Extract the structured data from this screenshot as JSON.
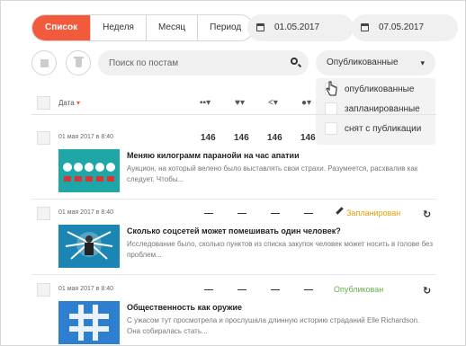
{
  "view_tabs": [
    "Список",
    "Неделя",
    "Месяц",
    "Период"
  ],
  "date_from": "01.05.2017",
  "date_to": "07.05.2017",
  "date_dash": "—",
  "search": {
    "placeholder": "Поиск по постам"
  },
  "status_filter": {
    "selected": "Опубликованные",
    "options": [
      "опубликованные",
      "запланированные",
      "снят с публикации"
    ]
  },
  "table_header": {
    "date_label": "Дата",
    "sort_arrow": "▾"
  },
  "posts": [
    {
      "date": "01 мая 2017 в 8:40",
      "socials": "— ▾ ◉ in",
      "stats": [
        "146",
        "146",
        "146",
        "146"
      ],
      "status": "",
      "title": "Меняю килограмм паранойи на час апатии",
      "desc": "Аукцион, на который велено было выставлять свои страхи. Разумеется, расхвалив как следует. Чтобы..."
    },
    {
      "date": "01 мая 2017 в 8:40",
      "socials": "— vk f ◎ f",
      "stats": [
        "—",
        "—",
        "—",
        "—"
      ],
      "status": "Запланирован",
      "status_color": "#e8a000",
      "title": "Сколько соцсетей может помешивать один человек?",
      "desc": "Исследование было, сколько пунктов из списка закупок человек может носить в голове без проблем..."
    },
    {
      "date": "01 мая 2017 в 8:40",
      "socials": "— vk f ◎ f",
      "stats": [
        "—",
        "—",
        "—",
        "—"
      ],
      "status": "Опубликован",
      "status_color": "#6ab04c",
      "title": "Общественность как оружие",
      "desc": "С ужасом тут просмотрела и прослушала длинную историю страданий Elle Richardson. Она собиралась стать..."
    }
  ],
  "icons": {
    "calendar": "calendar-icon",
    "grid": "grid-icon",
    "trash": "trash-icon",
    "search": "search-icon",
    "caret": "chevron-down-icon",
    "pencil": "pencil-icon",
    "refresh": "refresh-icon",
    "cursor": "hand-cursor-icon"
  },
  "colors": {
    "accent": "#f25a3c",
    "scheduled": "#e8a000",
    "published": "#6ab04c"
  }
}
